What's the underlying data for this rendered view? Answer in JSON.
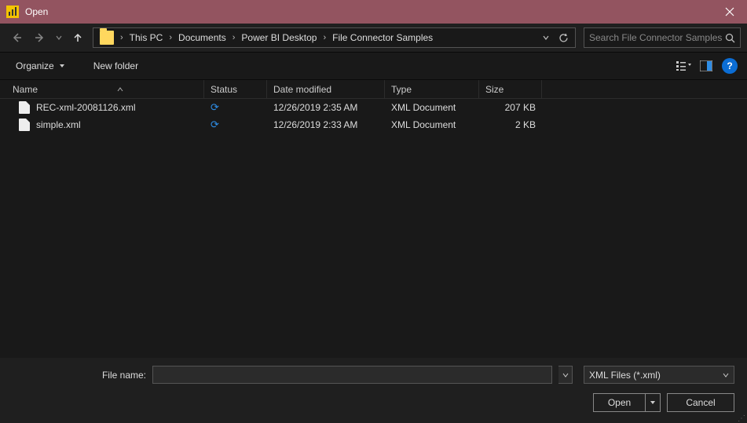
{
  "window": {
    "title": "Open"
  },
  "breadcrumb": {
    "parts": [
      "This PC",
      "Documents",
      "Power BI Desktop",
      "File Connector Samples"
    ]
  },
  "search": {
    "placeholder": "Search File Connector Samples"
  },
  "toolbar": {
    "organize": "Organize",
    "newfolder": "New folder"
  },
  "columns": {
    "name": "Name",
    "status": "Status",
    "date": "Date modified",
    "type": "Type",
    "size": "Size"
  },
  "files": [
    {
      "name": "REC-xml-20081126.xml",
      "date": "12/26/2019 2:35 AM",
      "type": "XML Document",
      "size": "207 KB"
    },
    {
      "name": "simple.xml",
      "date": "12/26/2019 2:33 AM",
      "type": "XML Document",
      "size": "2 KB"
    }
  ],
  "footer": {
    "filename_label": "File name:",
    "filename_value": "",
    "filter": "XML Files (*.xml)",
    "open": "Open",
    "cancel": "Cancel"
  },
  "help": "?"
}
